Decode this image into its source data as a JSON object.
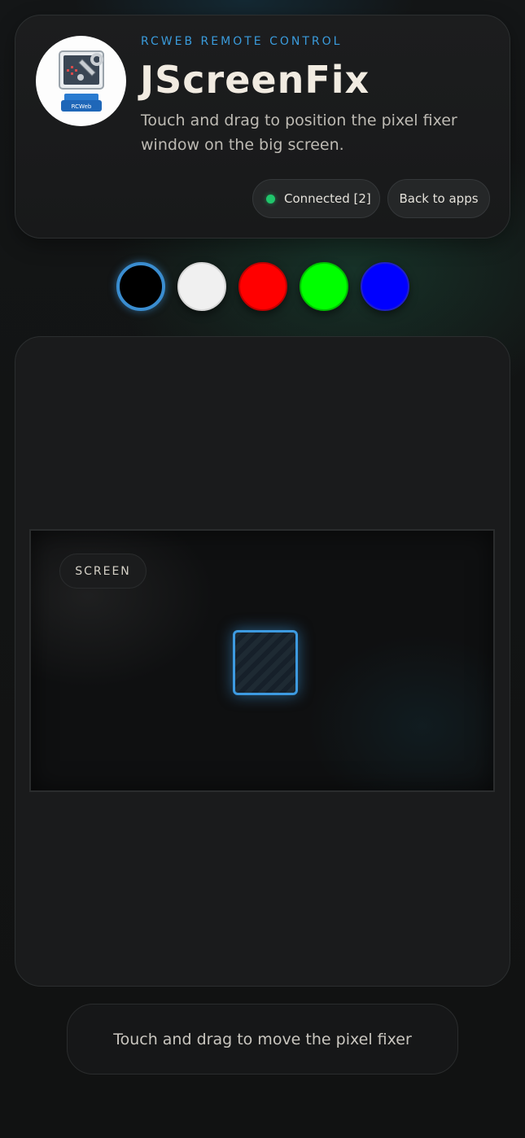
{
  "header": {
    "eyebrow": "RCWEB REMOTE CONTROL",
    "title": "JScreenFix",
    "subtitle": "Touch and drag to position the pixel fixer window on the big screen.",
    "logo_label": "RCWeb",
    "logo_icon": "wrench-monitor-icon"
  },
  "status": {
    "label": "Connected [2]",
    "color": "#20c56b"
  },
  "back_button": {
    "label": "Back to apps"
  },
  "swatches": [
    {
      "name": "black",
      "color": "#000000",
      "selected": true
    },
    {
      "name": "white",
      "color": "#f0f0f0",
      "selected": false
    },
    {
      "name": "red",
      "color": "#ff0000",
      "selected": false
    },
    {
      "name": "green",
      "color": "#00ff00",
      "selected": false
    },
    {
      "name": "blue",
      "color": "#0000ff",
      "selected": false
    }
  ],
  "screen": {
    "badge": "SCREEN",
    "accent": "#3d9ae0"
  },
  "hint": "Touch and drag to move the pixel fixer"
}
